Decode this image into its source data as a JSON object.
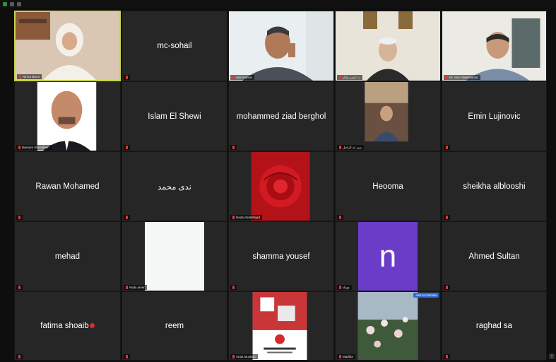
{
  "participants": [
    {
      "name": "Nimra Barut",
      "display": "video-woman",
      "caption": "Nimra Barut"
    },
    {
      "name": "mc-sohail",
      "display": "name",
      "caption": ""
    },
    {
      "name": "",
      "display": "video-man-desk",
      "caption": "atta hassan"
    },
    {
      "name": "",
      "display": "video-elder",
      "caption": "د / ياسر بشار"
    },
    {
      "name": "",
      "display": "video-man-office",
      "caption": "Dr. Amr AbdelHamid"
    },
    {
      "name": "",
      "display": "video-man-bald",
      "caption": "Bassam Elmeldeen"
    },
    {
      "name": "Islam El Shewi",
      "display": "name",
      "caption": ""
    },
    {
      "name": "mohammed ziad berghol",
      "display": "name",
      "caption": ""
    },
    {
      "name": "",
      "display": "video-young-man",
      "caption": "ميم عد الراجل"
    },
    {
      "name": "Emin Lujinovic",
      "display": "name",
      "caption": ""
    },
    {
      "name": "Rawan Mohamed",
      "display": "name",
      "caption": ""
    },
    {
      "name": "ندى محمد",
      "display": "name",
      "caption": ""
    },
    {
      "name": "",
      "display": "video-rose",
      "caption": "Nada AbdelMajid"
    },
    {
      "name": "Heooma",
      "display": "name",
      "caption": ""
    },
    {
      "name": "sheikha alblooshi",
      "display": "name",
      "caption": ""
    },
    {
      "name": "mehad",
      "display": "name",
      "caption": ""
    },
    {
      "name": "",
      "display": "white-screen",
      "caption": "Nejla amer"
    },
    {
      "name": "shamma yousef",
      "display": "name",
      "caption": ""
    },
    {
      "name": "",
      "display": "avatar-letter",
      "letter": "n",
      "caption": "هيفاء"
    },
    {
      "name": "Ahmed Sultan",
      "display": "name",
      "caption": ""
    },
    {
      "name": "fatima shoaib",
      "display": "name-heart",
      "caption": ""
    },
    {
      "name": "reem",
      "display": "name",
      "caption": ""
    },
    {
      "name": "",
      "display": "video-poster",
      "caption": "Anas Mustafa"
    },
    {
      "name": "",
      "display": "video-flowers",
      "caption": "Madiha",
      "badge": "Ask to Unmute"
    },
    {
      "name": "raghad sa",
      "display": "name",
      "caption": ""
    }
  ],
  "colors": {
    "background": "#0e0e0e",
    "tile": "#262626",
    "active_border": "#c9d34a",
    "avatar_purple": "#6b3cc8",
    "mic_muted": "#e03a3a"
  },
  "controls": {
    "next_page": "›"
  }
}
